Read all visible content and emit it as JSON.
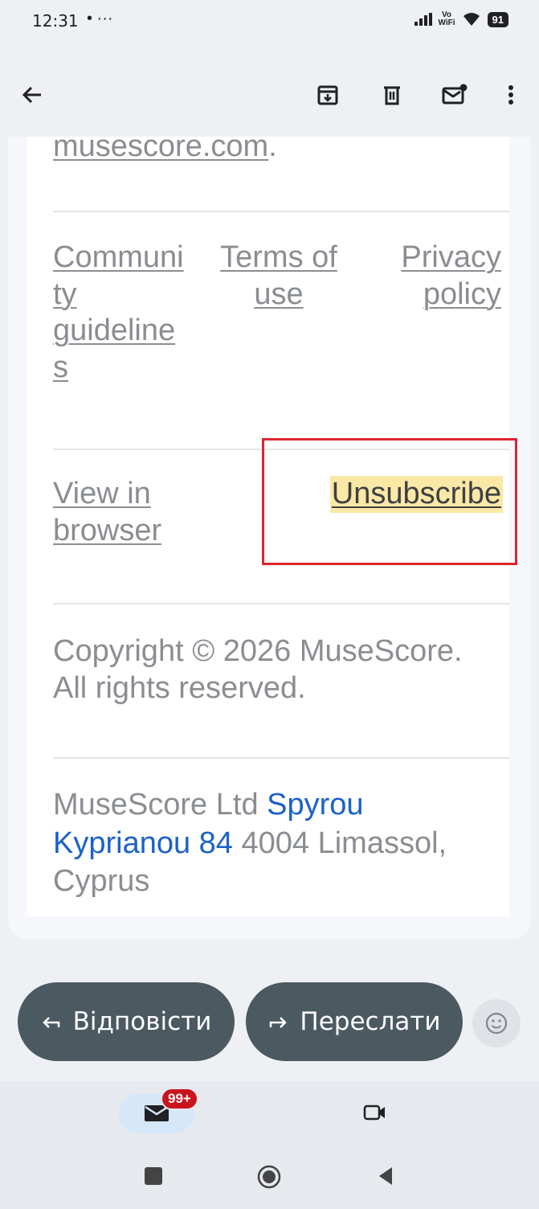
{
  "status_bar": {
    "time": "12:31",
    "extra": "• ···",
    "vowifi_top": "Vo",
    "vowifi_bottom": "WiFi",
    "battery": "91"
  },
  "toolbar": {
    "back_icon": "arrow-left-icon",
    "archive_icon": "archive-icon",
    "delete_icon": "trash-icon",
    "mark_unread_icon": "mail-unread-icon",
    "more_icon": "more-vertical-icon"
  },
  "email": {
    "domain_link": "musescore.com",
    "domain_period": ".",
    "footer_links": {
      "community_1": "Communi",
      "community_2": "ty",
      "community_3": "guideline",
      "community_4": "s",
      "terms_1": "Terms of",
      "terms_2": "use",
      "privacy_1": "Privacy",
      "privacy_2": "policy"
    },
    "view_in_browser_1": "View in",
    "view_in_browser_2": "browser",
    "unsubscribe": "Unsubscribe",
    "copyright": "Copyright © 2026 MuseScore. All rights reserved.",
    "address_prefix": "MuseScore Ltd ",
    "address_link": "Spyrou Kyprianou 84",
    "address_suffix": " 4004 Limassol, Cyprus"
  },
  "actions": {
    "reply_label": "Відповісти",
    "forward_label": "Переслати",
    "emoji_icon": "smiley-icon"
  },
  "bottom_nav": {
    "mail_badge": "99+",
    "mail_icon": "mail-icon",
    "meet_icon": "video-icon"
  },
  "colors": {
    "highlight": "#fce8a6",
    "annotation_box": "#e0242e",
    "link_blue": "#1a62c9",
    "action_button": "#4b5961"
  }
}
